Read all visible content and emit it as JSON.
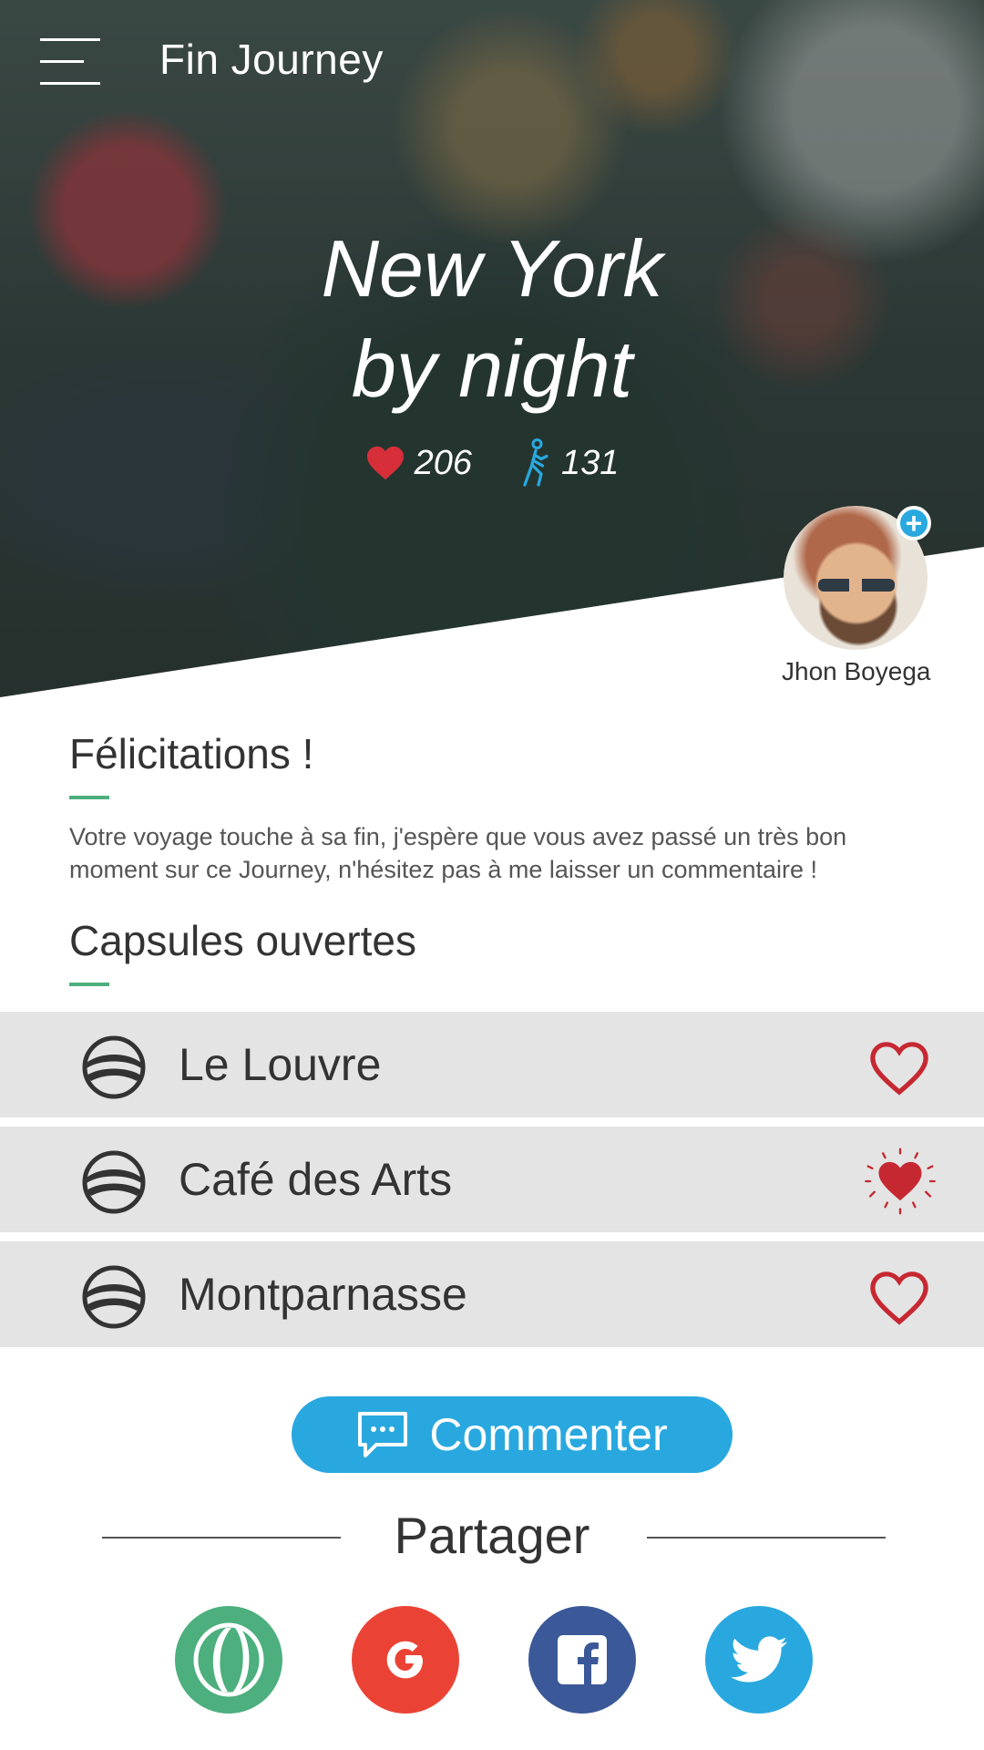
{
  "header": {
    "app_title": "Fin Journey"
  },
  "journey": {
    "title_line1": "New York",
    "title_line2": "by night",
    "likes": "206",
    "walkers": "131"
  },
  "author": {
    "name": "Jhon Boyega"
  },
  "congrats": {
    "title": "Félicitations !",
    "text": "Votre voyage touche à sa fin, j'espère que vous avez passé un très bon moment sur ce Journey, n'hésitez pas à me laisser un commentaire !"
  },
  "capsules": {
    "title": "Capsules ouvertes",
    "items": [
      {
        "label": "Le Louvre",
        "liked": false
      },
      {
        "label": "Café des Arts",
        "liked": true
      },
      {
        "label": "Montparnasse",
        "liked": false
      }
    ]
  },
  "comment_button": {
    "label": "Commenter"
  },
  "share": {
    "title": "Partager",
    "networks": [
      "app",
      "google",
      "facebook",
      "twitter"
    ]
  },
  "colors": {
    "accent_blue": "#29a8df",
    "heart_red": "#c62832",
    "underline_green": "#4caf7d",
    "google_red": "#ea4335",
    "facebook_blue": "#3b5998",
    "twitter_blue": "#29a8df",
    "app_green": "#4caf7d"
  },
  "icons": {
    "menu": "hamburger-icon",
    "likes": "heart-icon",
    "walkers": "walker-icon",
    "capsule": "capsule-icon",
    "comment": "chat-bubble-icon"
  }
}
